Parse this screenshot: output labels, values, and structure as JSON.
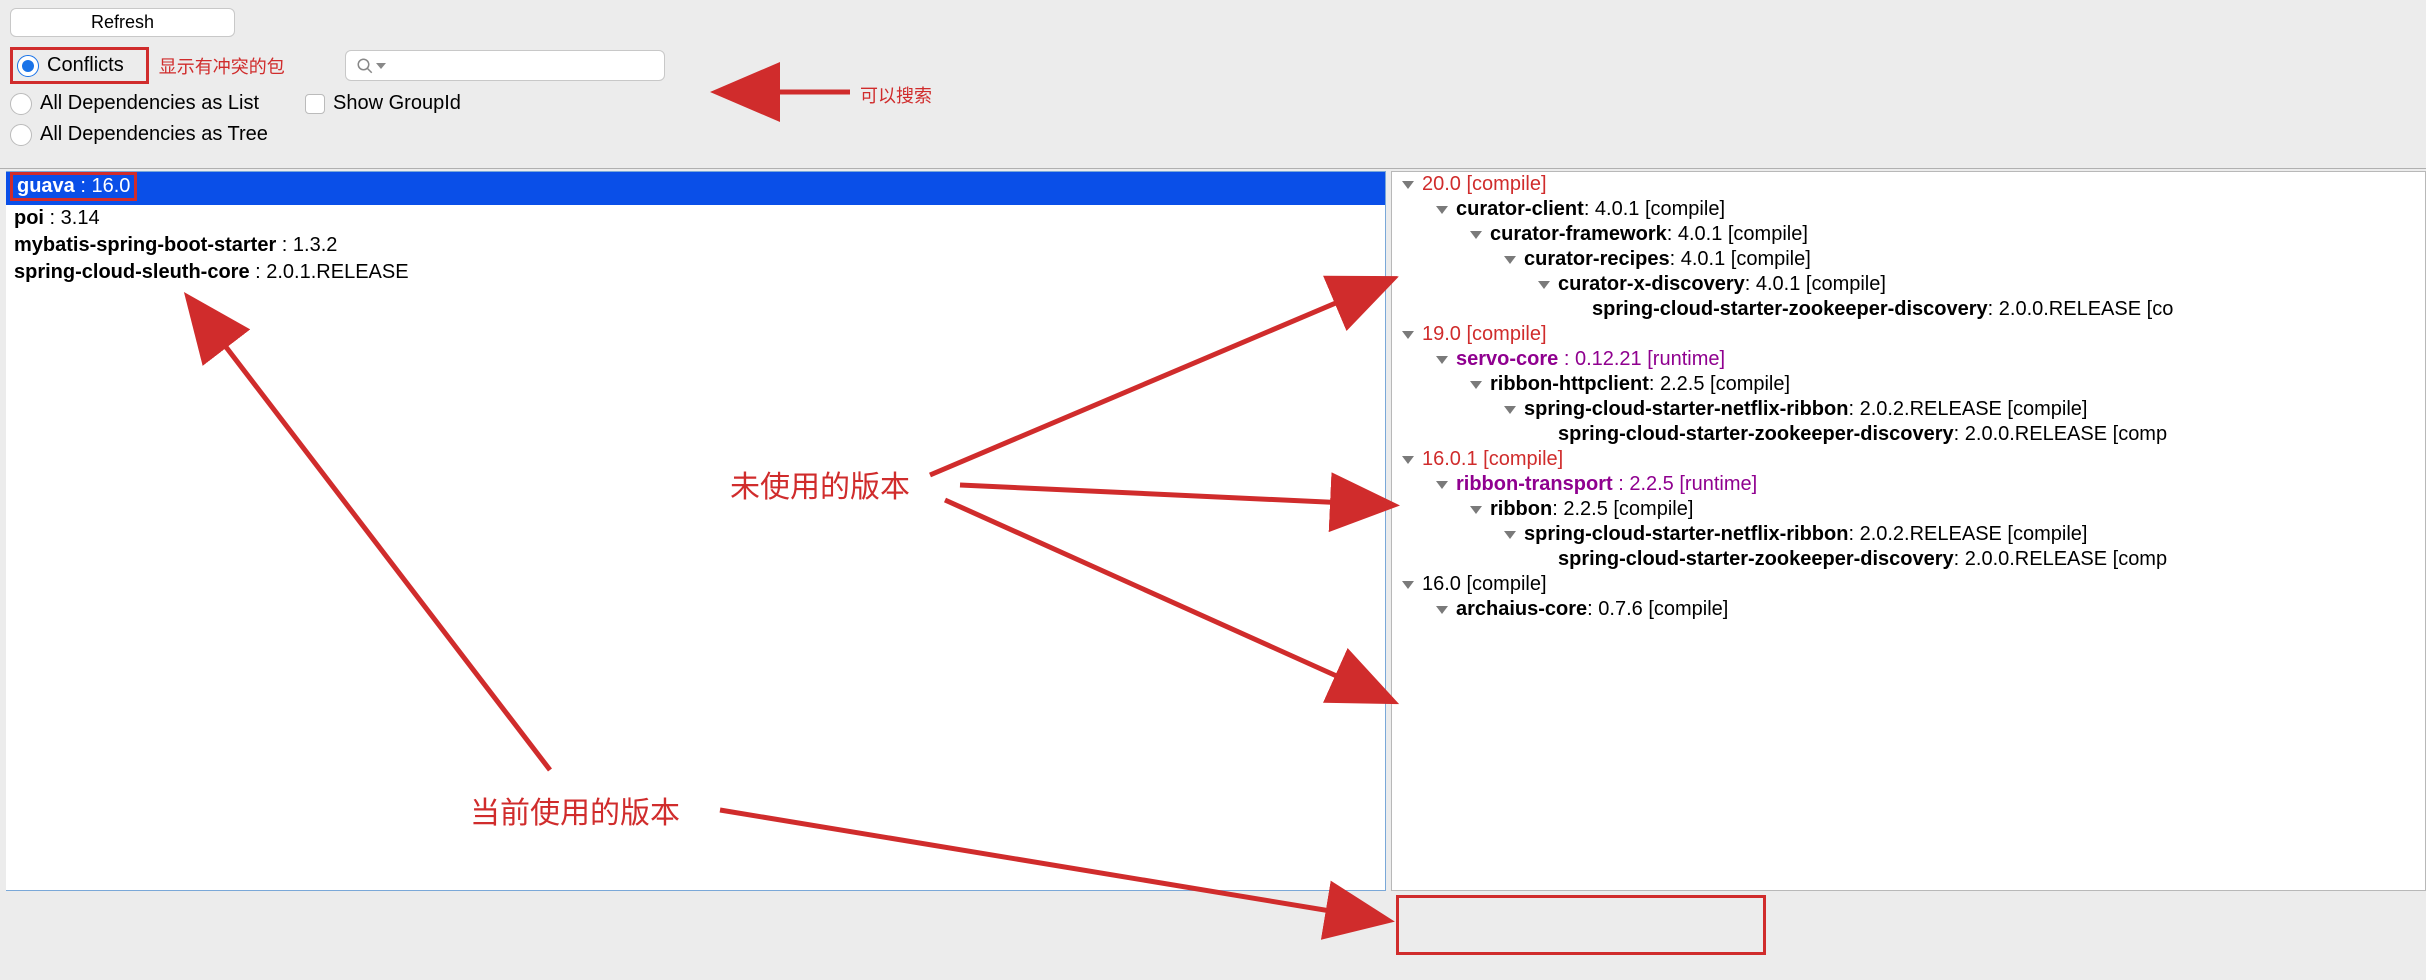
{
  "toolbar": {
    "refresh_label": "Refresh",
    "conflicts_label": "Conflicts",
    "all_list_label": "All Dependencies as List",
    "all_tree_label": "All Dependencies as Tree",
    "show_groupid_label": "Show GroupId",
    "search_placeholder": ""
  },
  "annotations": {
    "conflicts_desc": "显示有冲突的包",
    "search_desc": "可以搜索",
    "unused_versions": "未使用的版本",
    "current_version": "当前使用的版本"
  },
  "left_deps": [
    {
      "name": "guava",
      "ver": "16.0",
      "selected": true
    },
    {
      "name": "poi",
      "ver": "3.14",
      "selected": false
    },
    {
      "name": "mybatis-spring-boot-starter",
      "ver": "1.3.2",
      "selected": false
    },
    {
      "name": "spring-cloud-sleuth-core",
      "ver": "2.0.1.RELEASE",
      "selected": false
    }
  ],
  "tree": [
    {
      "ind": 0,
      "cls": "t-red",
      "text": "20.0 [compile]"
    },
    {
      "ind": 1,
      "cls": "t-black",
      "name": "curator-client",
      "rest": " : 4.0.1 [compile]"
    },
    {
      "ind": 2,
      "cls": "t-black",
      "name": "curator-framework",
      "rest": " : 4.0.1 [compile]"
    },
    {
      "ind": 3,
      "cls": "t-black",
      "name": "curator-recipes",
      "rest": " : 4.0.1 [compile]"
    },
    {
      "ind": 4,
      "cls": "t-black",
      "name": "curator-x-discovery",
      "rest": " : 4.0.1 [compile]"
    },
    {
      "ind": 5,
      "cls": "t-black",
      "noc": true,
      "name": "spring-cloud-starter-zookeeper-discovery",
      "rest": " : 2.0.0.RELEASE [co"
    },
    {
      "ind": 0,
      "cls": "t-red",
      "text": "19.0 [compile]"
    },
    {
      "ind": 1,
      "cls": "t-purple",
      "name": "servo-core",
      "restp": " : 0.12.21 [runtime]"
    },
    {
      "ind": 2,
      "cls": "t-black",
      "name": "ribbon-httpclient",
      "rest": " : 2.2.5 [compile]"
    },
    {
      "ind": 3,
      "cls": "t-black",
      "name": "spring-cloud-starter-netflix-ribbon",
      "rest": " : 2.0.2.RELEASE [compile]"
    },
    {
      "ind": 4,
      "cls": "t-black",
      "noc": true,
      "name": "spring-cloud-starter-zookeeper-discovery",
      "rest": " : 2.0.0.RELEASE [comp"
    },
    {
      "ind": 0,
      "cls": "t-red",
      "text": "16.0.1 [compile]"
    },
    {
      "ind": 1,
      "cls": "t-purple",
      "name": "ribbon-transport",
      "restp": " : 2.2.5 [runtime]"
    },
    {
      "ind": 2,
      "cls": "t-black",
      "name": "ribbon",
      "rest": " : 2.2.5 [compile]"
    },
    {
      "ind": 3,
      "cls": "t-black",
      "name": "spring-cloud-starter-netflix-ribbon",
      "rest": " : 2.0.2.RELEASE [compile]"
    },
    {
      "ind": 4,
      "cls": "t-black",
      "noc": true,
      "name": "spring-cloud-starter-zookeeper-discovery",
      "rest": " : 2.0.0.RELEASE [comp"
    },
    {
      "ind": 0,
      "cls": "t-black",
      "text": "16.0 [compile]"
    },
    {
      "ind": 1,
      "cls": "t-black",
      "name": "archaius-core",
      "rest": " : 0.7.6 [compile]"
    }
  ]
}
